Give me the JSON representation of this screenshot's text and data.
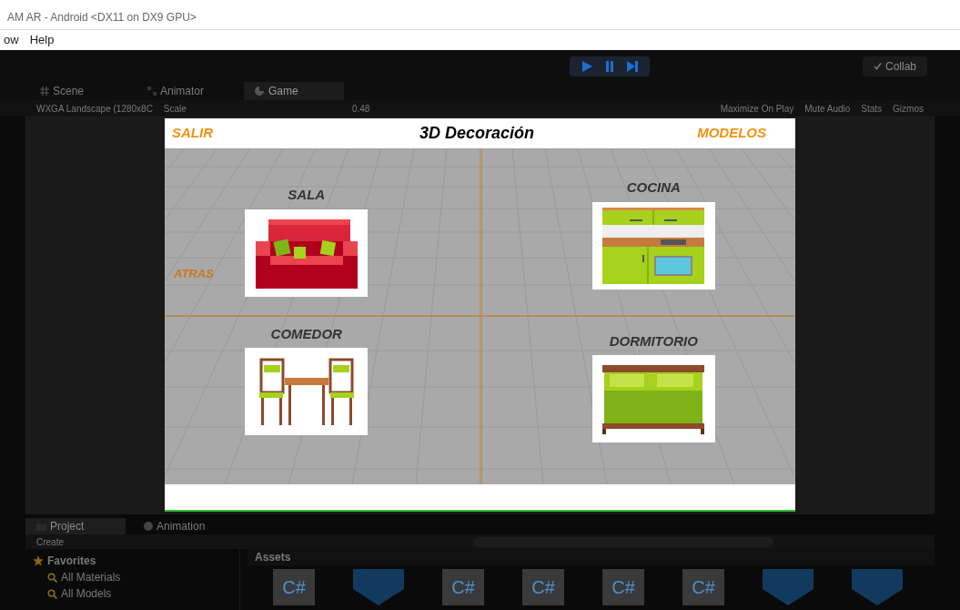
{
  "window": {
    "title": "AM AR - Android <DX11 on DX9 GPU>"
  },
  "menu": [
    "ow",
    "Help"
  ],
  "toolbar": {
    "controls": [
      {
        "kind": "play"
      },
      {
        "kind": "pause"
      },
      {
        "kind": "step"
      }
    ],
    "collab": "Collab"
  },
  "tabs": [
    {
      "label": "Scene",
      "kind": "scene",
      "selected": false
    },
    {
      "label": "Animator",
      "kind": "animator",
      "selected": false
    },
    {
      "label": "Game",
      "kind": "game",
      "selected": true
    }
  ],
  "game_toolbar": {
    "resolution": "WXGA Landscape (1280x8C",
    "scale_label": "Scale",
    "scale_value": "0.48",
    "toggles": [
      "Maximize On Play",
      "Mute Audio",
      "Stats"
    ],
    "gizmos": "Gizmos"
  },
  "game": {
    "left_button": "SALIR",
    "title": "3D Decoración",
    "right_button": "MODELOS",
    "back_button": "ATRAS",
    "categories": [
      {
        "label": "SALA",
        "kind": "sofa"
      },
      {
        "label": "COCINA",
        "kind": "kitchen"
      },
      {
        "label": "COMEDOR",
        "kind": "dining"
      },
      {
        "label": "DORMITORIO",
        "kind": "bed"
      }
    ]
  },
  "bottom_tabs": [
    {
      "label": "Project",
      "kind": "project",
      "selected": true
    },
    {
      "label": "Animation",
      "kind": "animation",
      "selected": false
    }
  ],
  "create": "Create",
  "favorites": {
    "title": "Favorites",
    "items": [
      "All Materials",
      "All Models"
    ]
  },
  "assets": {
    "title": "Assets",
    "items": [
      {
        "kind": "script",
        "label": "C#"
      },
      {
        "kind": "model"
      },
      {
        "kind": "script",
        "label": "C#"
      },
      {
        "kind": "script",
        "label": "C#"
      },
      {
        "kind": "script",
        "label": "C#"
      },
      {
        "kind": "script",
        "label": "C#"
      },
      {
        "kind": "model"
      },
      {
        "kind": "model"
      }
    ]
  }
}
